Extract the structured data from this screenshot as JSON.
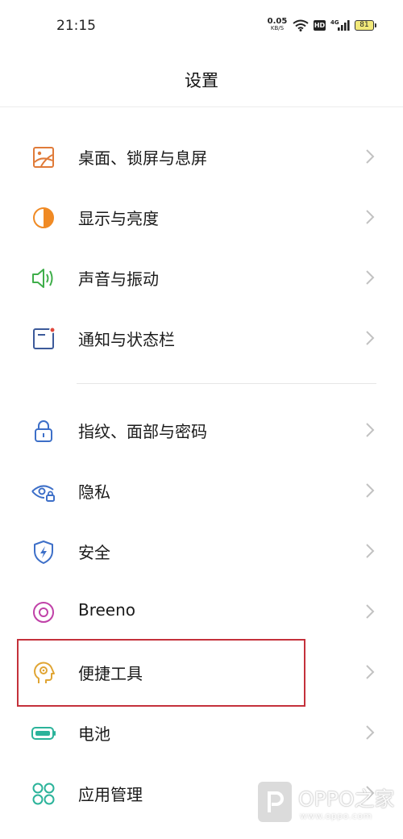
{
  "status_bar": {
    "time": "21:15",
    "net_speed_value": "0.05",
    "net_speed_unit": "KB/S",
    "hd_label": "HD",
    "network_type": "4G",
    "battery_level": "81"
  },
  "header": {
    "title": "设置"
  },
  "settings": {
    "items": [
      {
        "label": "桌面、锁屏与息屏",
        "icon": "wallpaper-icon",
        "color": "#e07b39"
      },
      {
        "label": "显示与亮度",
        "icon": "brightness-icon",
        "color": "#f08a24"
      },
      {
        "label": "声音与振动",
        "icon": "speaker-icon",
        "color": "#3fae4a"
      },
      {
        "label": "通知与状态栏",
        "icon": "notification-icon",
        "color": "#3c5a9a"
      },
      {
        "label": "指纹、面部与密码",
        "icon": "lock-icon",
        "color": "#3d6fc8"
      },
      {
        "label": "隐私",
        "icon": "privacy-eye-icon",
        "color": "#3d6fc8"
      },
      {
        "label": "安全",
        "icon": "shield-icon",
        "color": "#3d6fc8"
      },
      {
        "label": "Breeno",
        "icon": "breeno-icon",
        "color": "#c041a8"
      },
      {
        "label": "便捷工具",
        "icon": "head-gear-icon",
        "color": "#e0a534"
      },
      {
        "label": "电池",
        "icon": "battery-icon",
        "color": "#2bb39a"
      },
      {
        "label": "应用管理",
        "icon": "apps-icon",
        "color": "#2bb39a"
      }
    ]
  },
  "watermark": {
    "brand": "OPPO之家",
    "url": "www.oppo.com"
  }
}
